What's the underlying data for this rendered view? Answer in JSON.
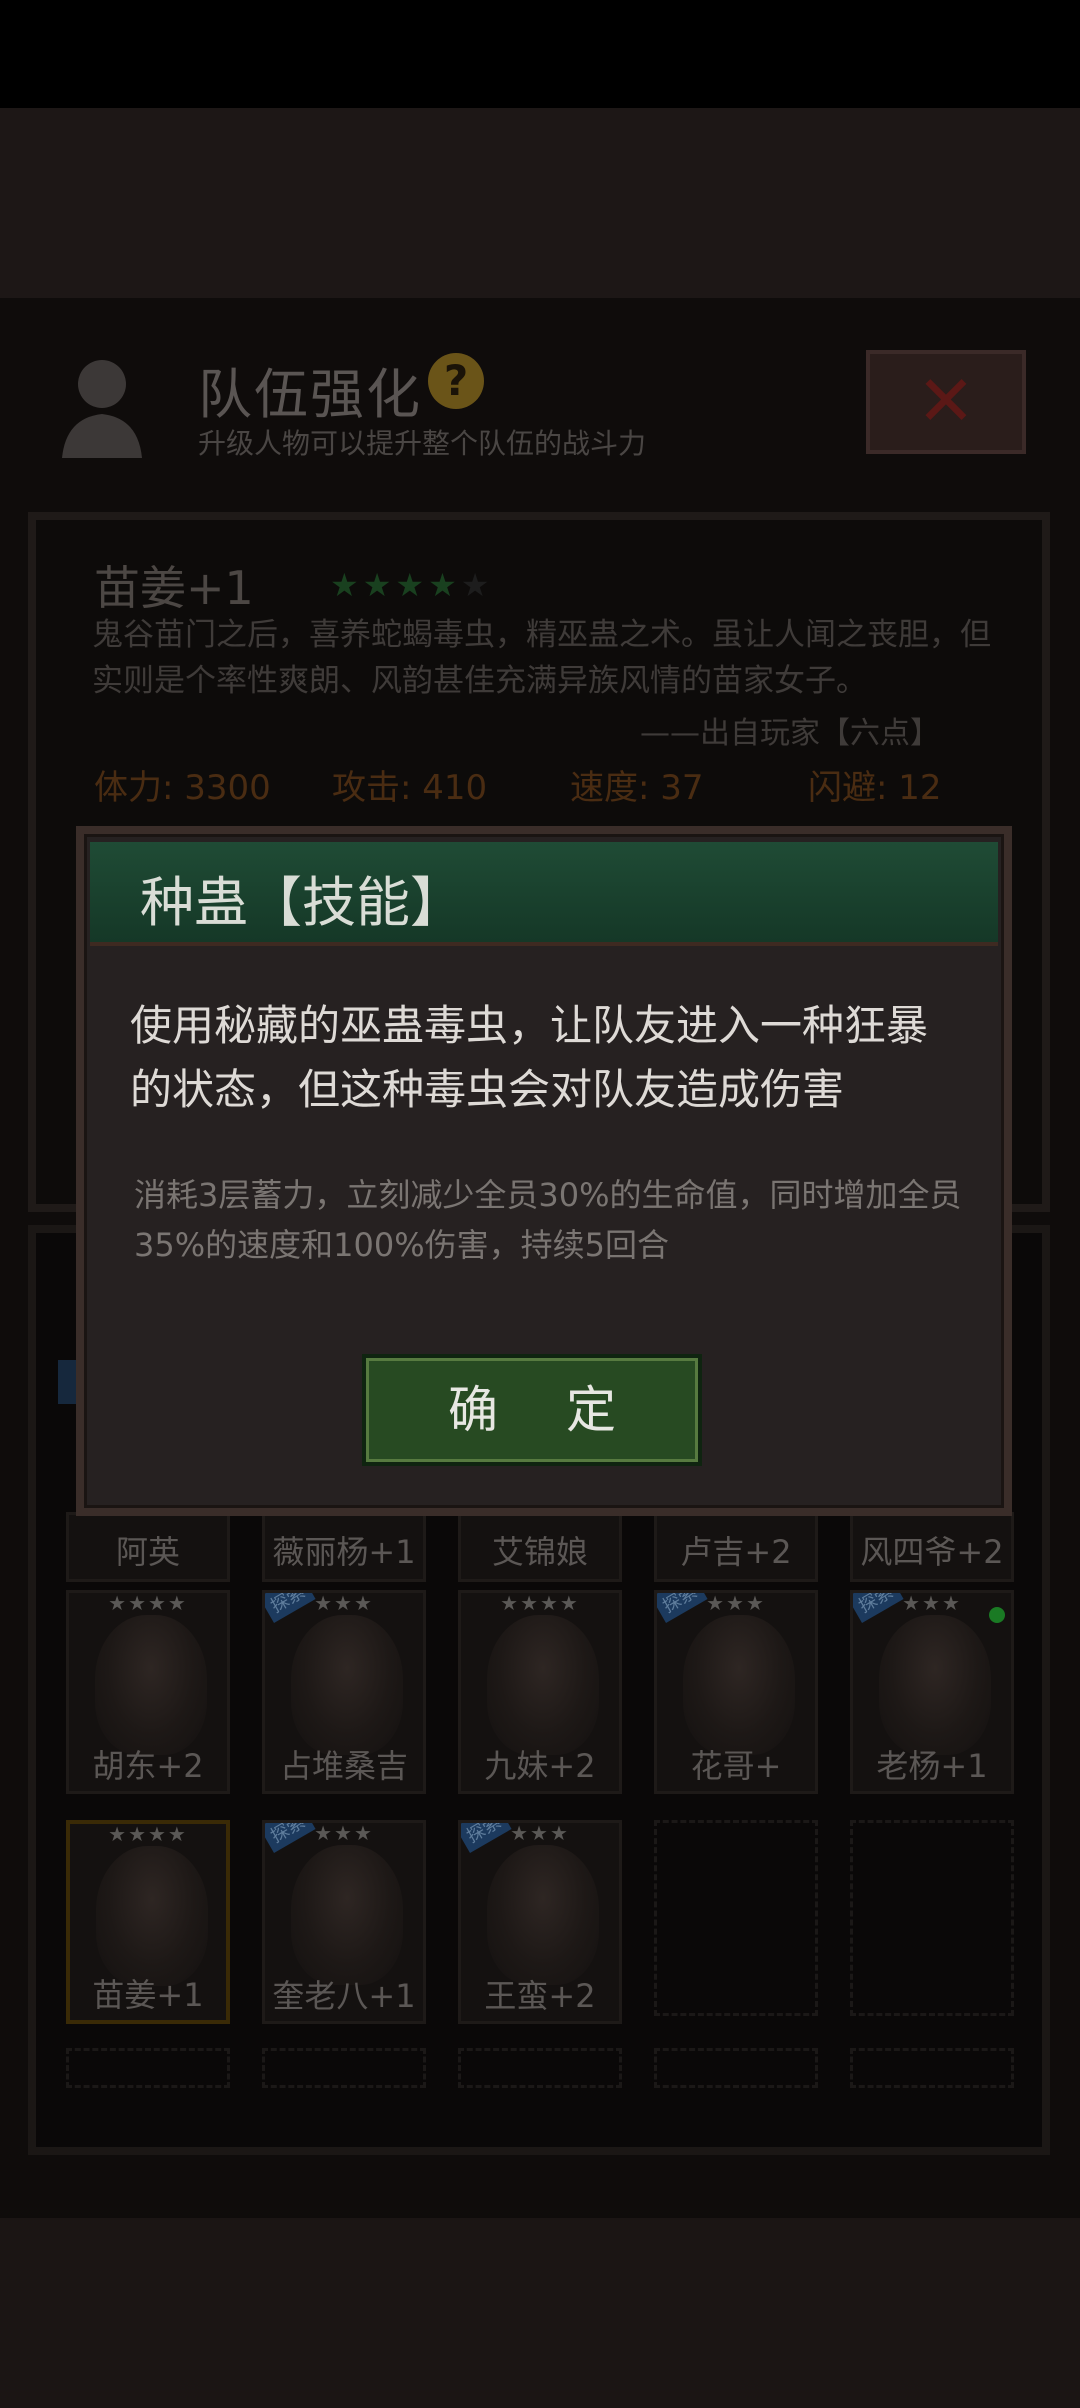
{
  "header": {
    "title": "队伍强化",
    "help_icon": "?",
    "subtitle": "升级人物可以提升整个队伍的战斗力",
    "close_icon": "✕"
  },
  "character": {
    "name": "苗姜+1",
    "stars_filled": "★★★★",
    "stars_empty": "★",
    "description": "鬼谷苗门之后，喜养蛇蝎毒虫，精巫蛊之术。虽让人闻之丧胆，但实则是个率性爽朗、风韵甚佳充满异族风情的苗家女子。",
    "source": "——出自玩家【六点】",
    "stats": {
      "hp": "体力: 3300",
      "atk": "攻击: 410",
      "spd": "速度: 37",
      "dodge": "闪避: 12"
    }
  },
  "skill_dialog": {
    "title": "种蛊【技能】",
    "main_text": "使用秘藏的巫蛊毒虫，让队友进入一种狂暴的状态，但这种毒虫会对队友造成伤害",
    "detail_text": "消耗3层蓄力，立刻减少全员30%的生命值，同时增加全员35%的速度和100%伤害，持续5回合",
    "confirm_label": "确 定"
  },
  "roster": {
    "tag_label": "探索",
    "row1": [
      "阿英",
      "薇丽杨+1",
      "艾锦娘",
      "卢吉+2",
      "风四爷+2"
    ],
    "row2": [
      {
        "name": "胡东+2",
        "stars": "★★★★"
      },
      {
        "name": "占堆桑吉",
        "stars": "★★★"
      },
      {
        "name": "九妹+2",
        "stars": "★★★★"
      },
      {
        "name": "花哥+",
        "stars": "★★★"
      },
      {
        "name": "老杨+1",
        "stars": "★★★"
      }
    ],
    "row3": [
      {
        "name": "苗姜+1",
        "stars": "★★★★"
      },
      {
        "name": "奎老八+1",
        "stars": "★★★"
      },
      {
        "name": "王蛮+2",
        "stars": "★★★"
      }
    ]
  }
}
